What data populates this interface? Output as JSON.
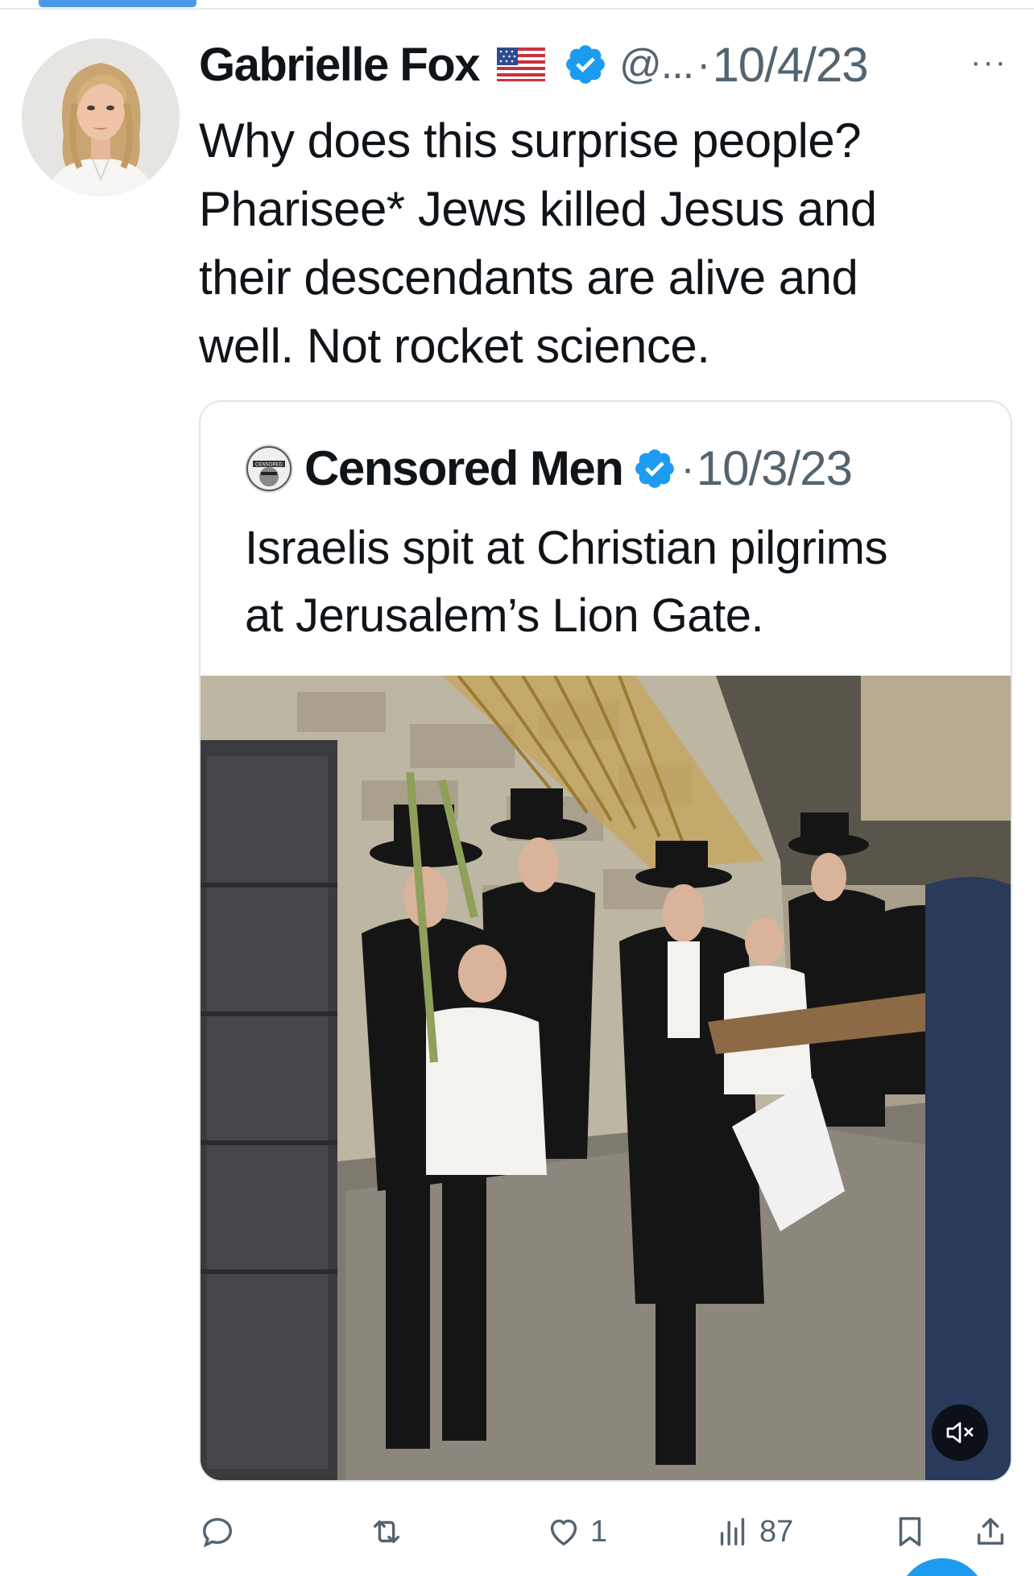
{
  "tweet": {
    "author": {
      "name": "Gabrielle Fox",
      "flag_emoji": "🇺🇸",
      "handle": "@...",
      "verified": true
    },
    "separator": "·",
    "date": "10/4/23",
    "more_label": "···",
    "text": "Why does this surprise people?\nPharisee* Jews killed Jesus and\ntheir descendants are alive and\nwell. Not rocket science."
  },
  "quoted_tweet": {
    "author": {
      "name": "Censored Men",
      "verified": true,
      "avatar_text": "CENSORED"
    },
    "separator": "·",
    "date": "10/3/23",
    "text": "Israelis spit at Christian pilgrims\nat Jerusalem’s Lion Gate.",
    "media": {
      "type": "video",
      "muted": true,
      "mute_icon": "speaker-muted-icon"
    }
  },
  "actions": {
    "reply": {
      "icon": "reply-icon",
      "count": ""
    },
    "retweet": {
      "icon": "retweet-icon",
      "count": ""
    },
    "like": {
      "icon": "heart-icon",
      "count": "1"
    },
    "views": {
      "icon": "views-bar-chart-icon",
      "count": "87"
    },
    "bookmark": {
      "icon": "bookmark-icon"
    },
    "share": {
      "icon": "share-icon"
    }
  },
  "colors": {
    "accent": "#1d9bf0",
    "text_primary": "#0f1419",
    "text_secondary": "#536471",
    "border": "#e1e5e8"
  }
}
